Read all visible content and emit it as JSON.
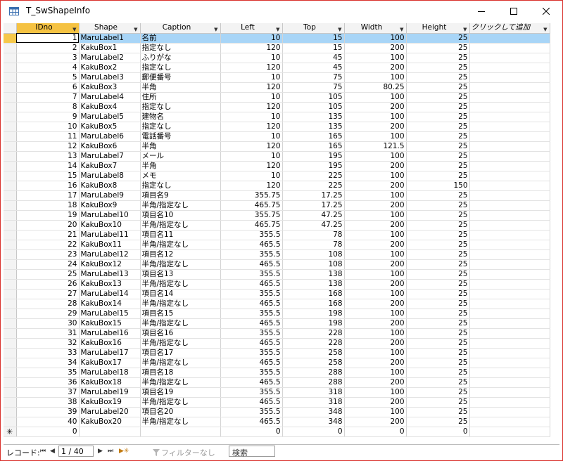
{
  "window": {
    "title": "T_SwShapeInfo"
  },
  "icons": {
    "table": "table-icon",
    "minimize": "minimize-icon",
    "maximize": "maximize-icon",
    "close": "close-icon"
  },
  "columns": [
    "IDno",
    "Shape",
    "Caption",
    "Left",
    "Top",
    "Width",
    "Height",
    "クリックして追加"
  ],
  "rows": [
    [
      "1",
      "MaruLabel1",
      "名前",
      "10",
      "15",
      "100",
      "25"
    ],
    [
      "2",
      "KakuBox1",
      "指定なし",
      "120",
      "15",
      "200",
      "25"
    ],
    [
      "3",
      "MaruLabel2",
      "ふりがな",
      "10",
      "45",
      "100",
      "25"
    ],
    [
      "4",
      "KakuBox2",
      "指定なし",
      "120",
      "45",
      "200",
      "25"
    ],
    [
      "5",
      "MaruLabel3",
      "郵便番号",
      "10",
      "75",
      "100",
      "25"
    ],
    [
      "6",
      "KakuBox3",
      "半角",
      "120",
      "75",
      "80.25",
      "25"
    ],
    [
      "7",
      "MaruLabel4",
      "住所",
      "10",
      "105",
      "100",
      "25"
    ],
    [
      "8",
      "KakuBox4",
      "指定なし",
      "120",
      "105",
      "200",
      "25"
    ],
    [
      "9",
      "MaruLabel5",
      "建物名",
      "10",
      "135",
      "100",
      "25"
    ],
    [
      "10",
      "KakuBox5",
      "指定なし",
      "120",
      "135",
      "200",
      "25"
    ],
    [
      "11",
      "MaruLabel6",
      "電話番号",
      "10",
      "165",
      "100",
      "25"
    ],
    [
      "12",
      "KakuBox6",
      "半角",
      "120",
      "165",
      "121.5",
      "25"
    ],
    [
      "13",
      "MaruLabel7",
      "メール",
      "10",
      "195",
      "100",
      "25"
    ],
    [
      "14",
      "KakuBox7",
      "半角",
      "120",
      "195",
      "200",
      "25"
    ],
    [
      "15",
      "MaruLabel8",
      "メモ",
      "10",
      "225",
      "100",
      "25"
    ],
    [
      "16",
      "KakuBox8",
      "指定なし",
      "120",
      "225",
      "200",
      "150"
    ],
    [
      "17",
      "MaruLabel9",
      "項目名9",
      "355.75",
      "17.25",
      "100",
      "25"
    ],
    [
      "18",
      "KakuBox9",
      "半角/指定なし",
      "465.75",
      "17.25",
      "200",
      "25"
    ],
    [
      "19",
      "MaruLabel10",
      "項目名10",
      "355.75",
      "47.25",
      "100",
      "25"
    ],
    [
      "20",
      "KakuBox10",
      "半角/指定なし",
      "465.75",
      "47.25",
      "200",
      "25"
    ],
    [
      "21",
      "MaruLabel11",
      "項目名11",
      "355.5",
      "78",
      "100",
      "25"
    ],
    [
      "22",
      "KakuBox11",
      "半角/指定なし",
      "465.5",
      "78",
      "200",
      "25"
    ],
    [
      "23",
      "MaruLabel12",
      "項目名12",
      "355.5",
      "108",
      "100",
      "25"
    ],
    [
      "24",
      "KakuBox12",
      "半角/指定なし",
      "465.5",
      "108",
      "200",
      "25"
    ],
    [
      "25",
      "MaruLabel13",
      "項目名13",
      "355.5",
      "138",
      "100",
      "25"
    ],
    [
      "26",
      "KakuBox13",
      "半角/指定なし",
      "465.5",
      "138",
      "200",
      "25"
    ],
    [
      "27",
      "MaruLabel14",
      "項目名14",
      "355.5",
      "168",
      "100",
      "25"
    ],
    [
      "28",
      "KakuBox14",
      "半角/指定なし",
      "465.5",
      "168",
      "200",
      "25"
    ],
    [
      "29",
      "MaruLabel15",
      "項目名15",
      "355.5",
      "198",
      "100",
      "25"
    ],
    [
      "30",
      "KakuBox15",
      "半角/指定なし",
      "465.5",
      "198",
      "200",
      "25"
    ],
    [
      "31",
      "MaruLabel16",
      "項目名16",
      "355.5",
      "228",
      "100",
      "25"
    ],
    [
      "32",
      "KakuBox16",
      "半角/指定なし",
      "465.5",
      "228",
      "200",
      "25"
    ],
    [
      "33",
      "MaruLabel17",
      "項目名17",
      "355.5",
      "258",
      "100",
      "25"
    ],
    [
      "34",
      "KakuBox17",
      "半角/指定なし",
      "465.5",
      "258",
      "200",
      "25"
    ],
    [
      "35",
      "MaruLabel18",
      "項目名18",
      "355.5",
      "288",
      "100",
      "25"
    ],
    [
      "36",
      "KakuBox18",
      "半角/指定なし",
      "465.5",
      "288",
      "200",
      "25"
    ],
    [
      "37",
      "MaruLabel19",
      "項目名19",
      "355.5",
      "318",
      "100",
      "25"
    ],
    [
      "38",
      "KakuBox19",
      "半角/指定なし",
      "465.5",
      "318",
      "200",
      "25"
    ],
    [
      "39",
      "MaruLabel20",
      "項目名20",
      "355.5",
      "348",
      "100",
      "25"
    ],
    [
      "40",
      "KakuBox20",
      "半角/指定なし",
      "465.5",
      "348",
      "200",
      "25"
    ]
  ],
  "new_row": {
    "marker": "✳",
    "defaults": [
      "0",
      "",
      "",
      "0",
      "0",
      "0",
      "0"
    ]
  },
  "navigator": {
    "label": "レコード:",
    "first": "⏮",
    "prev": "◀",
    "position": "1 / 40",
    "next": "▶",
    "last": "⏭",
    "new": "▶✳",
    "filter": "フィルターなし",
    "search": "検索"
  },
  "colors": {
    "accent_border": "#d9302c",
    "current_row": "#a8d5f7",
    "header_sort": "#f5c242"
  }
}
